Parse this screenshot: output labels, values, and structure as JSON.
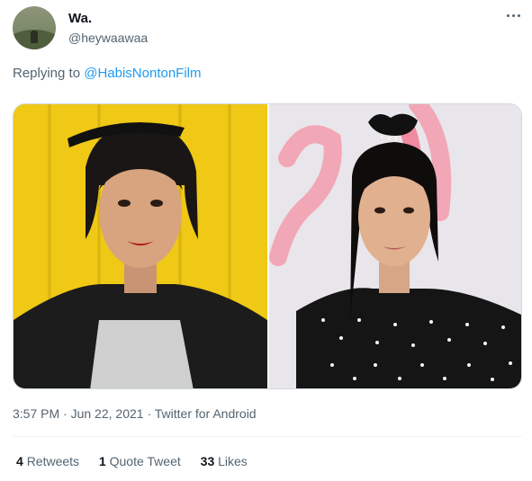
{
  "tweet": {
    "display_name": "Wa.",
    "handle": "@heywaawaa",
    "replying_to_label": "Replying to",
    "replying_to_handle": "@HabisNontonFilm",
    "time": "3:57 PM",
    "date": "Jun 22, 2021",
    "source": "Twitter for Android",
    "separator": "·"
  },
  "stats": {
    "retweets_count": "4",
    "retweets_label": "Retweets",
    "quotes_count": "1",
    "quotes_label": "Quote Tweet",
    "likes_count": "33",
    "likes_label": "Likes"
  },
  "colors": {
    "accent": "#1d9bf0",
    "secondary_text": "#536471",
    "primary_text": "#0f1419"
  },
  "icons": {
    "more": "more-horizontal-icon"
  }
}
